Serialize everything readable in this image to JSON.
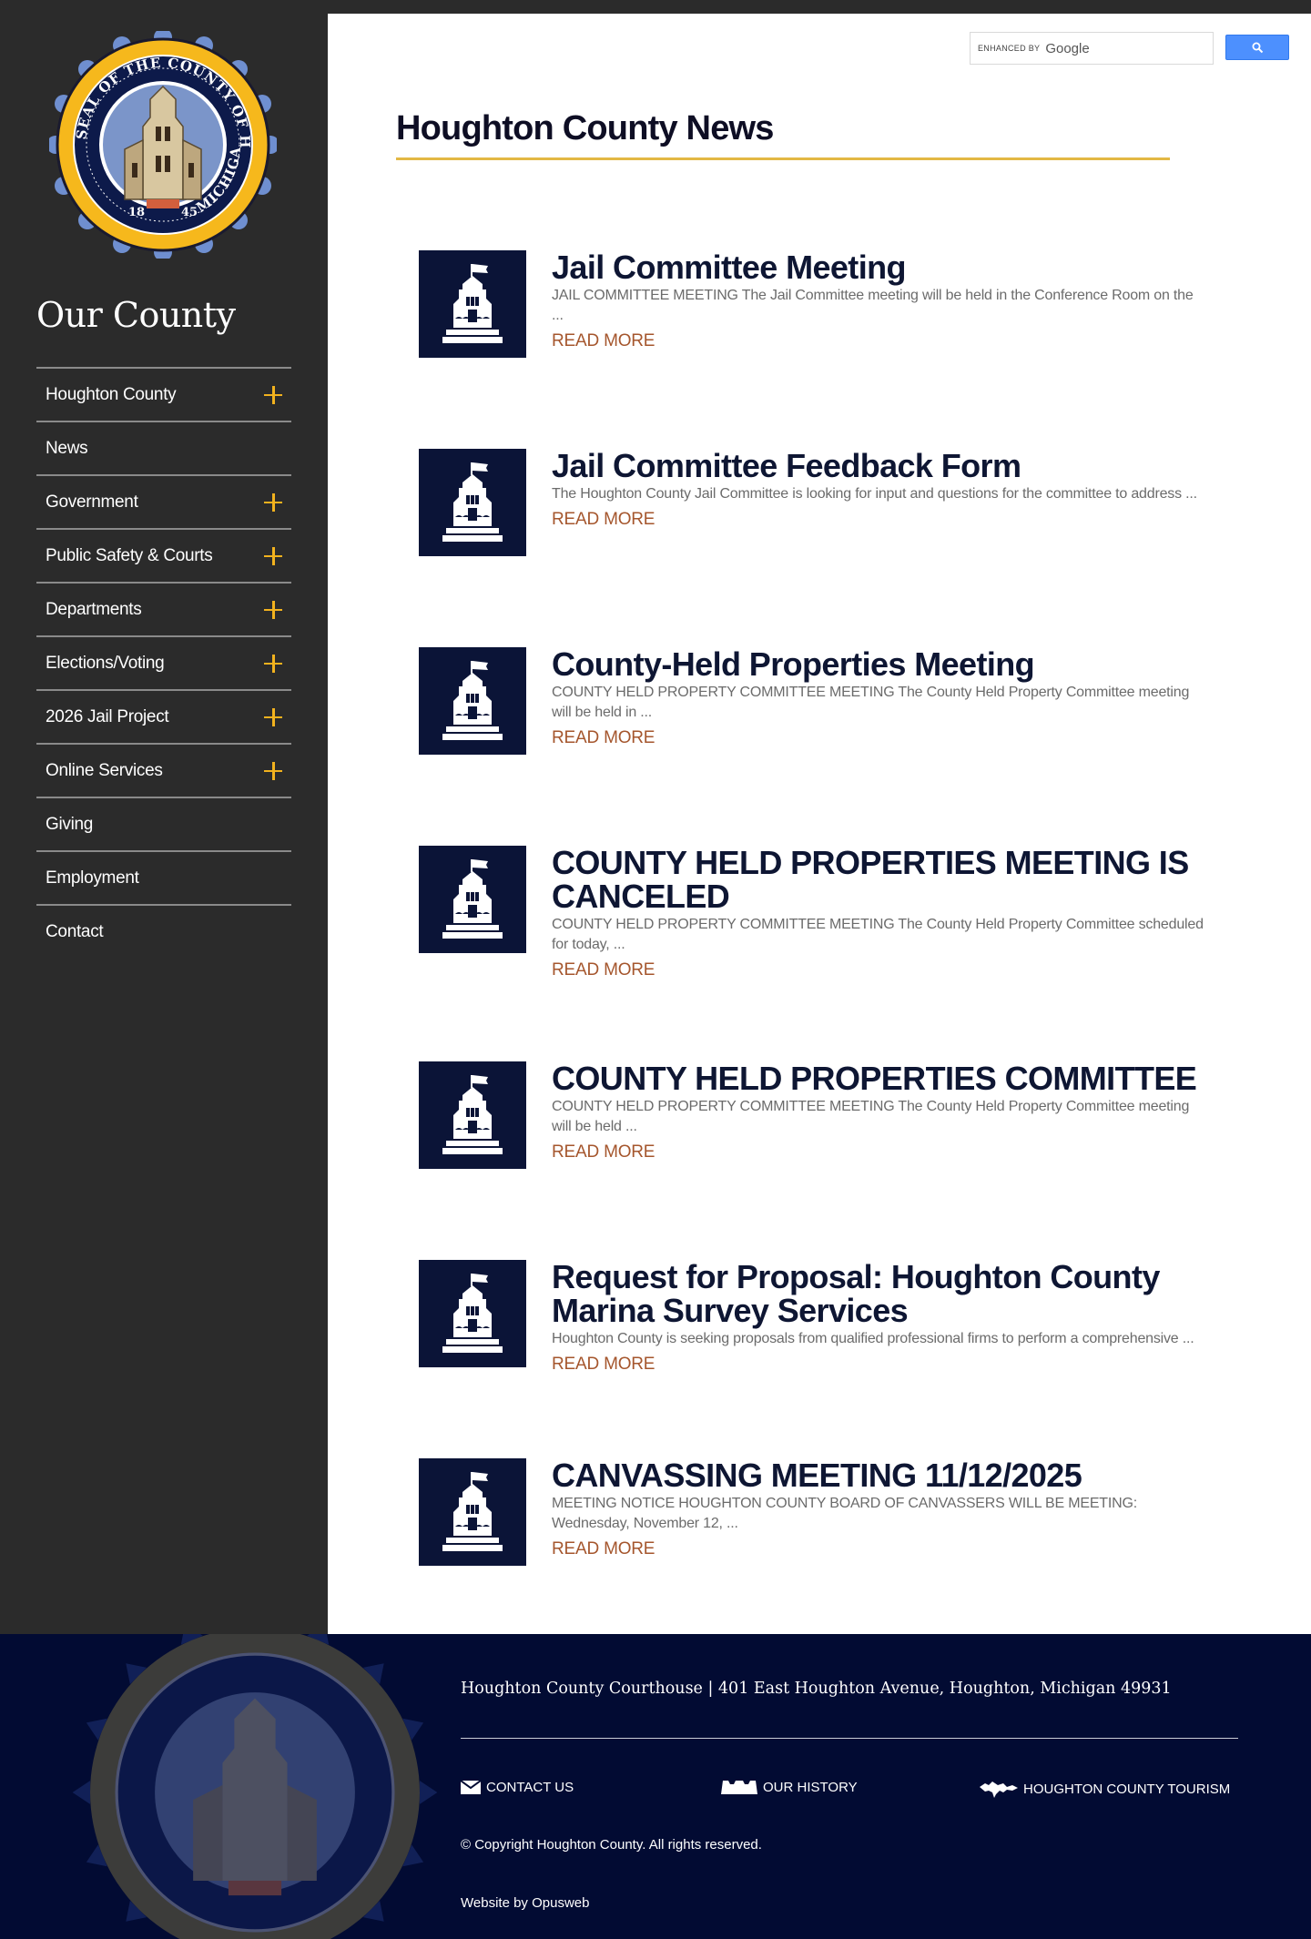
{
  "search": {
    "enhanced_by": "ENHANCED BY",
    "google": "Google",
    "placeholder": ""
  },
  "sidebar": {
    "seal_text_top": "SEAL OF THE COUNTY OF HOUGHTON",
    "seal_text_bottom": "MICHIGAN",
    "seal_year_left": "18",
    "seal_year_right": "45",
    "title": "Our County",
    "items": [
      {
        "label": "Houghton County",
        "expandable": true
      },
      {
        "label": "News",
        "expandable": false
      },
      {
        "label": "Government",
        "expandable": true
      },
      {
        "label": "Public Safety & Courts",
        "expandable": true
      },
      {
        "label": "Departments",
        "expandable": true
      },
      {
        "label": "Elections/Voting",
        "expandable": true
      },
      {
        "label": "2026 Jail Project",
        "expandable": true
      },
      {
        "label": "Online Services",
        "expandable": true
      },
      {
        "label": "Giving",
        "expandable": false
      },
      {
        "label": "Employment",
        "expandable": false
      },
      {
        "label": "Contact",
        "expandable": false
      }
    ]
  },
  "main": {
    "page_title": "Houghton County News",
    "read_more": "READ MORE",
    "articles": [
      {
        "title": "Jail Committee Meeting",
        "excerpt": "JAIL COMMITTEE MEETING The Jail Committee meeting will be held in the Conference Room on the ..."
      },
      {
        "title": "Jail Committee Feedback Form",
        "excerpt": "The Houghton County Jail Committee is looking for input and questions for the committee to address ..."
      },
      {
        "title": "County-Held Properties Meeting",
        "excerpt": "COUNTY HELD PROPERTY COMMITTEE MEETING The County Held Property Committee meeting will be held in ..."
      },
      {
        "title": "COUNTY HELD PROPERTIES MEETING IS CANCELED",
        "excerpt": "COUNTY HELD PROPERTY COMMITTEE MEETING The County Held Property Committee scheduled for today, ..."
      },
      {
        "title": "COUNTY HELD PROPERTIES COMMITTEE",
        "excerpt": "COUNTY HELD PROPERTY COMMITTEE MEETING The County Held Property Committee meeting will be held ..."
      },
      {
        "title": "Request for Proposal: Houghton County Marina Survey Services",
        "excerpt": "Houghton County is seeking proposals from qualified professional firms to perform a comprehensive ..."
      },
      {
        "title": "CANVASSING MEETING 11/12/2025",
        "excerpt": "MEETING NOTICE HOUGHTON COUNTY BOARD OF CANVASSERS WILL BE MEETING: Wednesday, November 12, ..."
      }
    ]
  },
  "footer": {
    "address": "Houghton County Courthouse  |  401 East Houghton Avenue, Houghton, Michigan 49931",
    "links": {
      "contact": "CONTACT US",
      "history": "OUR HISTORY",
      "tourism": "HOUGHTON COUNTY TOURISM"
    },
    "copyright": "© Copyright Houghton County. All rights reserved.",
    "website_by": "Website by Opusweb"
  },
  "colors": {
    "sidebar_bg": "#2b2b2b",
    "accent_gold": "#f2b21e",
    "navy": "#0b1437",
    "read_more": "#a5562d",
    "footer_bg": "#020b33"
  }
}
